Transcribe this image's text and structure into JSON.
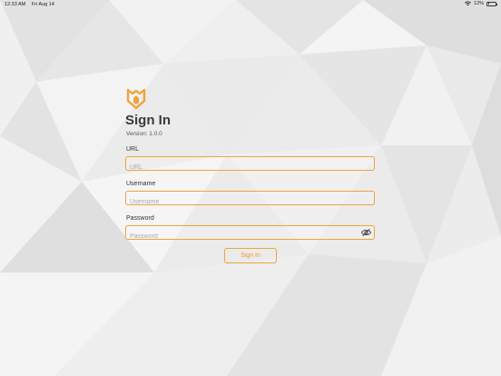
{
  "status_bar": {
    "time": "12:33 AM",
    "date": "Fri Aug 14",
    "battery": "12%",
    "battery_level": 0.12
  },
  "signin": {
    "title": "Sign In",
    "version": "Version: 1.0.0",
    "url_label": "URL",
    "url_placeholder": "URL",
    "username_label": "Username",
    "username_placeholder": "Username",
    "password_label": "Password",
    "password_placeholder": "Password",
    "button_label": "Sign In"
  },
  "colors": {
    "accent": "#f0a33a",
    "background": "#ececec"
  },
  "icons": {
    "logo": "shield-logo-icon",
    "password_toggle": "eye-slash-icon",
    "wifi": "wifi-icon",
    "battery": "battery-icon"
  }
}
